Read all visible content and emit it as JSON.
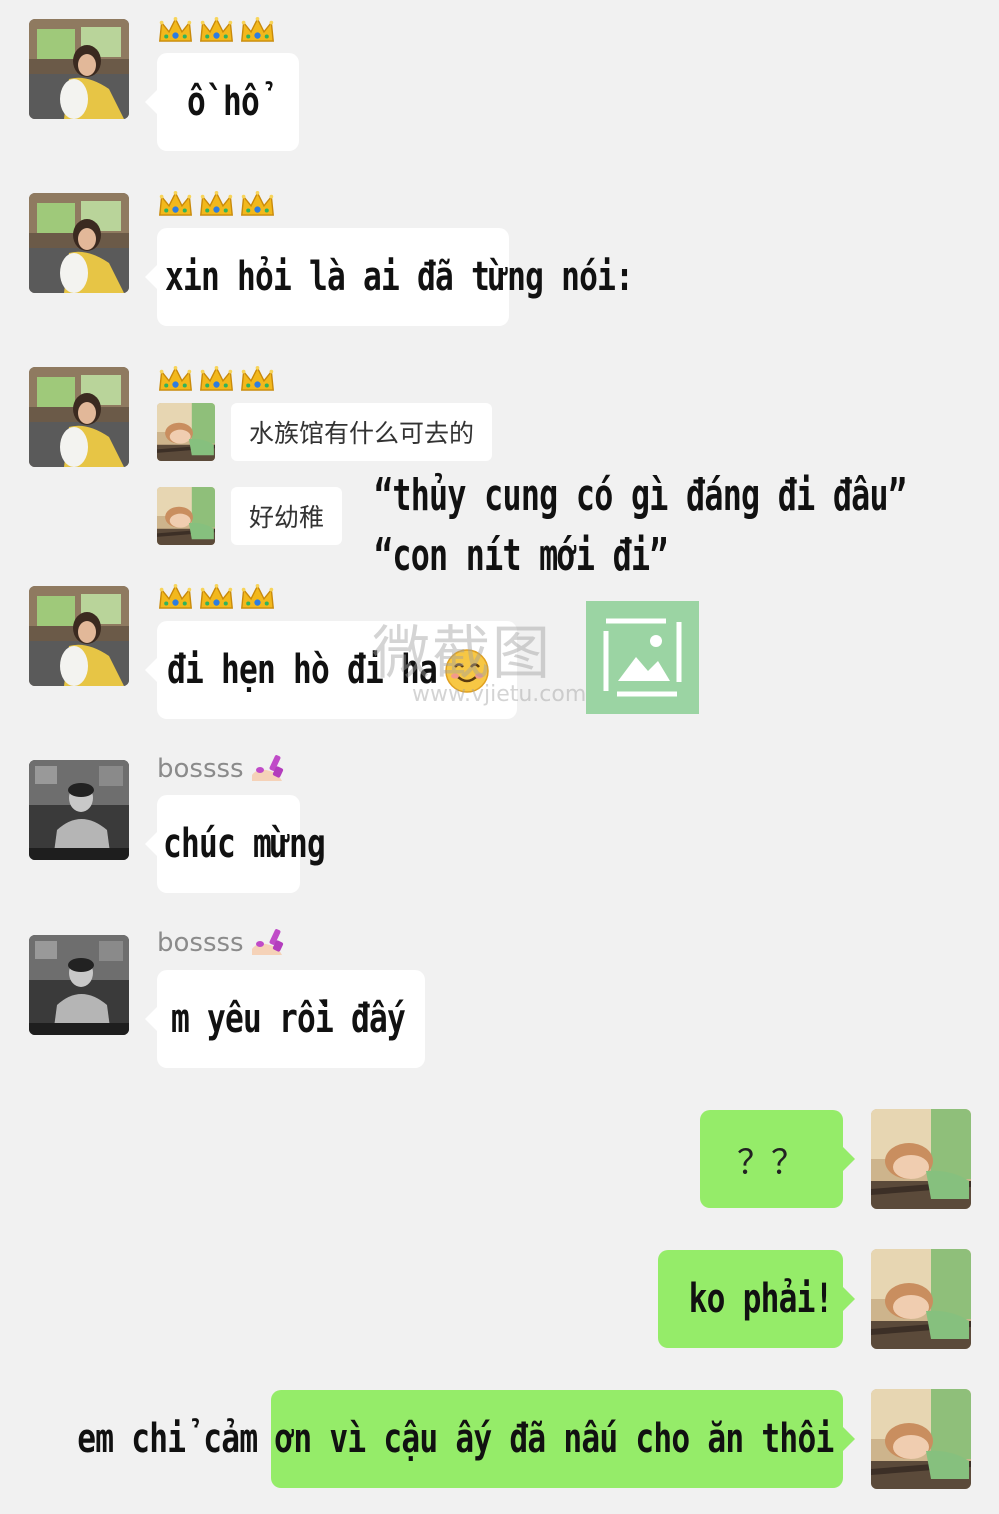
{
  "messages": [
    {
      "sender_badge": "crowns",
      "text": "ồ hổ"
    },
    {
      "sender_badge": "crowns",
      "text": "xin hỏi là ai đã từng nói:"
    },
    {
      "sender_badge": "crowns",
      "quotes": [
        "水族馆有什么可去的",
        "好幼稚"
      ]
    },
    {
      "sender_badge": "crowns",
      "text": "đi hẹn hò đi ha"
    },
    {
      "sender_name": "bossss",
      "text": "chúc mừng"
    },
    {
      "sender_name": "bossss",
      "text": "m yêu rồi đấy"
    },
    {
      "outgoing": true,
      "text": "？？"
    },
    {
      "outgoing": true,
      "text": "ko phải!"
    },
    {
      "outgoing": true,
      "text": "em chỉ cảm ơn vì cậu ấy đã nấu cho ăn thôi"
    }
  ],
  "captions": {
    "line1": "“thủy cung có gì đáng đi đâu”",
    "line2": "“con nít mới đi”"
  },
  "watermark": {
    "main": "微截图",
    "url": "www.vjietu.com"
  },
  "icons": {
    "crown": "crown-emoji-icon",
    "nail_polish": "nail-polish-emoji-icon",
    "smile": "smiling-face-emoji-icon",
    "watermark_logo": "image-frame-icon"
  },
  "colors": {
    "background": "#f1f1f1",
    "incoming_bubble": "#ffffff",
    "outgoing_bubble": "#95ec69"
  }
}
